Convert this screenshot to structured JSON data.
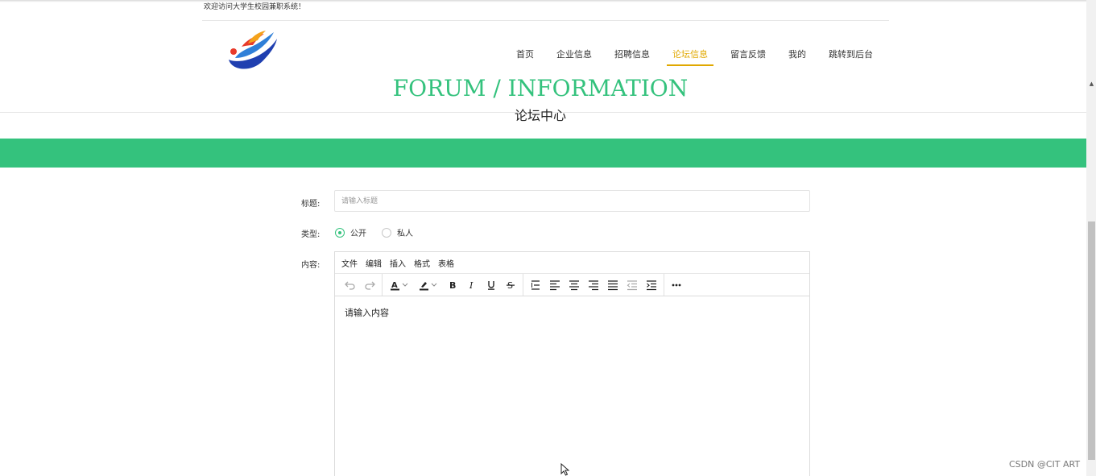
{
  "header": {
    "welcome": "欢迎访问大学生校园兼职系统！",
    "nav": [
      "首页",
      "企业信息",
      "招聘信息",
      "论坛信息",
      "留言反馈",
      "我的",
      "跳转到后台"
    ],
    "active_nav": "论坛信息"
  },
  "hero": {
    "title": "FORUM / INFORMATION",
    "subtitle": "论坛中心"
  },
  "form": {
    "title_label": "标题:",
    "title_placeholder": "请输入标题",
    "type_label": "类型:",
    "type_options": [
      "公开",
      "私人"
    ],
    "type_selected": "公开",
    "content_label": "内容:"
  },
  "editor": {
    "menus": [
      "文件",
      "编辑",
      "插入",
      "格式",
      "表格"
    ],
    "content_placeholder": "请输入内容"
  },
  "watermark": "CSDN @CIT ART",
  "colors": {
    "brand_green": "#34c27d",
    "nav_active": "#e0a800"
  }
}
